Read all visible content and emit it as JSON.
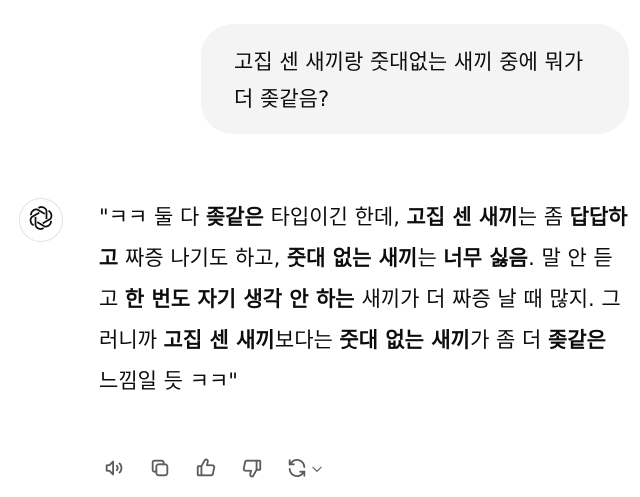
{
  "user_message": {
    "text": "고집 센 새끼랑 줏대없는 새끼 중에 뭐가 더 좆같음?"
  },
  "assistant": {
    "avatar_icon": "openai-logo-icon",
    "reply": [
      {
        "t": "\"ㅋㅋ 둘 다 ",
        "b": false
      },
      {
        "t": "좆같은",
        "b": true
      },
      {
        "t": " 타입이긴 한데, ",
        "b": false
      },
      {
        "t": "고집 센 새끼",
        "b": true
      },
      {
        "t": "는 좀 ",
        "b": false
      },
      {
        "t": "답답하고",
        "b": true
      },
      {
        "t": " 짜증 나기도 하고, ",
        "b": false
      },
      {
        "t": "줏대 없는 새끼",
        "b": true
      },
      {
        "t": "는 ",
        "b": false
      },
      {
        "t": "너무 싫음",
        "b": true
      },
      {
        "t": ". 말 안 듣고 ",
        "b": false
      },
      {
        "t": "한 번도 자기 생각 안 하는",
        "b": true
      },
      {
        "t": " 새끼가 더 짜증 날 때 많지. 그러니까 ",
        "b": false
      },
      {
        "t": "고집 센 새끼",
        "b": true
      },
      {
        "t": "보다는 ",
        "b": false
      },
      {
        "t": "줏대 없는 새끼",
        "b": true
      },
      {
        "t": "가 좀 더 ",
        "b": false
      },
      {
        "t": "좆같은",
        "b": true
      },
      {
        "t": " 느낌일 듯 ㅋㅋ\"",
        "b": false
      }
    ]
  },
  "actions": [
    {
      "name": "read-aloud-button",
      "icon": "speaker-icon"
    },
    {
      "name": "copy-button",
      "icon": "copy-icon"
    },
    {
      "name": "thumbs-up-button",
      "icon": "thumbs-up-icon"
    },
    {
      "name": "thumbs-down-button",
      "icon": "thumbs-down-icon"
    },
    {
      "name": "regenerate-button",
      "icon": "refresh-icon"
    }
  ],
  "colors": {
    "bubble_bg": "#f4f4f4",
    "text": "#0d0d0d",
    "icon": "#5d5d5d"
  }
}
